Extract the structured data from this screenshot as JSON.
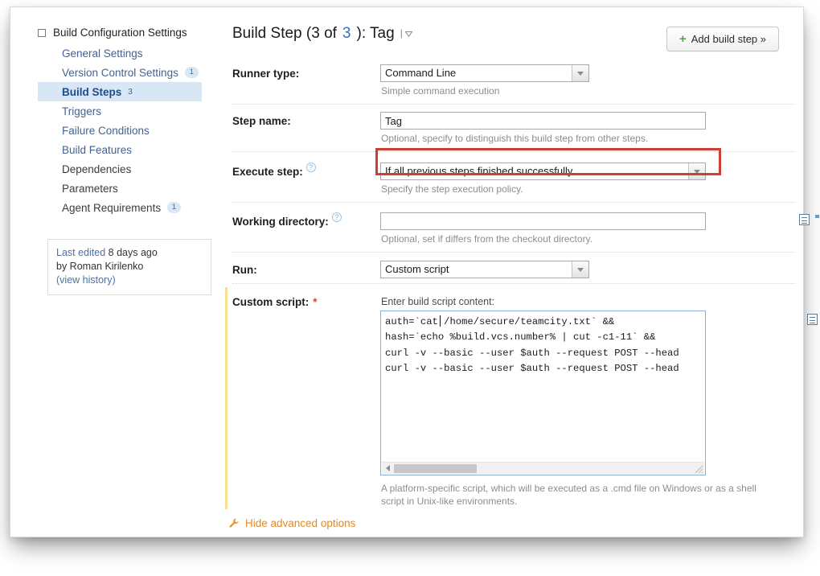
{
  "sidebar": {
    "root_label": "Build Configuration Settings",
    "items": [
      {
        "label": "General Settings",
        "badge": "",
        "selected": false
      },
      {
        "label": "Version Control Settings",
        "badge": "1",
        "selected": false
      },
      {
        "label": "Build Steps",
        "badge": "3",
        "selected": true
      },
      {
        "label": "Triggers",
        "badge": "",
        "selected": false
      },
      {
        "label": "Failure Conditions",
        "badge": "",
        "selected": false
      },
      {
        "label": "Build Features",
        "badge": "",
        "selected": false
      },
      {
        "label": "Dependencies",
        "badge": "",
        "selected": false
      },
      {
        "label": "Parameters",
        "badge": "",
        "selected": false
      },
      {
        "label": "Agent Requirements",
        "badge": "1",
        "selected": false
      }
    ],
    "last_edited": {
      "prefix": "Last edited",
      "when": " 8 days ago",
      "by": "by Roman Kirilenko",
      "history_link": "(view history)"
    }
  },
  "header": {
    "title_prefix": "Build Step (3 of ",
    "title_count": "3",
    "title_suffix": "): Tag",
    "add_button_label": "Add build step »",
    "add_button_plus": "+"
  },
  "form": {
    "runner_type": {
      "label": "Runner type:",
      "value": "Command Line",
      "hint": "Simple command execution"
    },
    "step_name": {
      "label": "Step name:",
      "value": "Tag",
      "placeholder": "",
      "hint": "Optional, specify to distinguish this build step from other steps."
    },
    "execute_step": {
      "label": "Execute step:",
      "help": "?",
      "value": "If all previous steps finished successfully",
      "hint": "Specify the step execution policy."
    },
    "working_directory": {
      "label": "Working directory:",
      "help": "?",
      "value": "",
      "placeholder": "",
      "hint": "Optional, set if differs from the checkout directory."
    },
    "run": {
      "label": "Run:",
      "value": "Custom script"
    },
    "custom_script": {
      "label": "Custom script:",
      "required_marker": "*",
      "textarea_label": "Enter build script content:",
      "value": "auth=`cat /home/secure/teamcity.txt` &&\nhash=`echo %build.vcs.number% | cut -c1-11` &&\ncurl -v --basic --user $auth --request POST --head\ncurl -v --basic --user $auth --request POST --head",
      "hint": "A platform-specific script, which will be executed as a .cmd file on Windows or as a shell script in Unix-like environments."
    }
  },
  "advanced_toggle": {
    "label": "Hide advanced options"
  },
  "colors": {
    "accent_blue": "#46628c",
    "selected_bg": "#d9e6f5",
    "highlight_red": "#cc3f33",
    "advanced_bar": "#f6df8f",
    "toggle_orange": "#e08a25",
    "plus_green": "#4ca844"
  }
}
